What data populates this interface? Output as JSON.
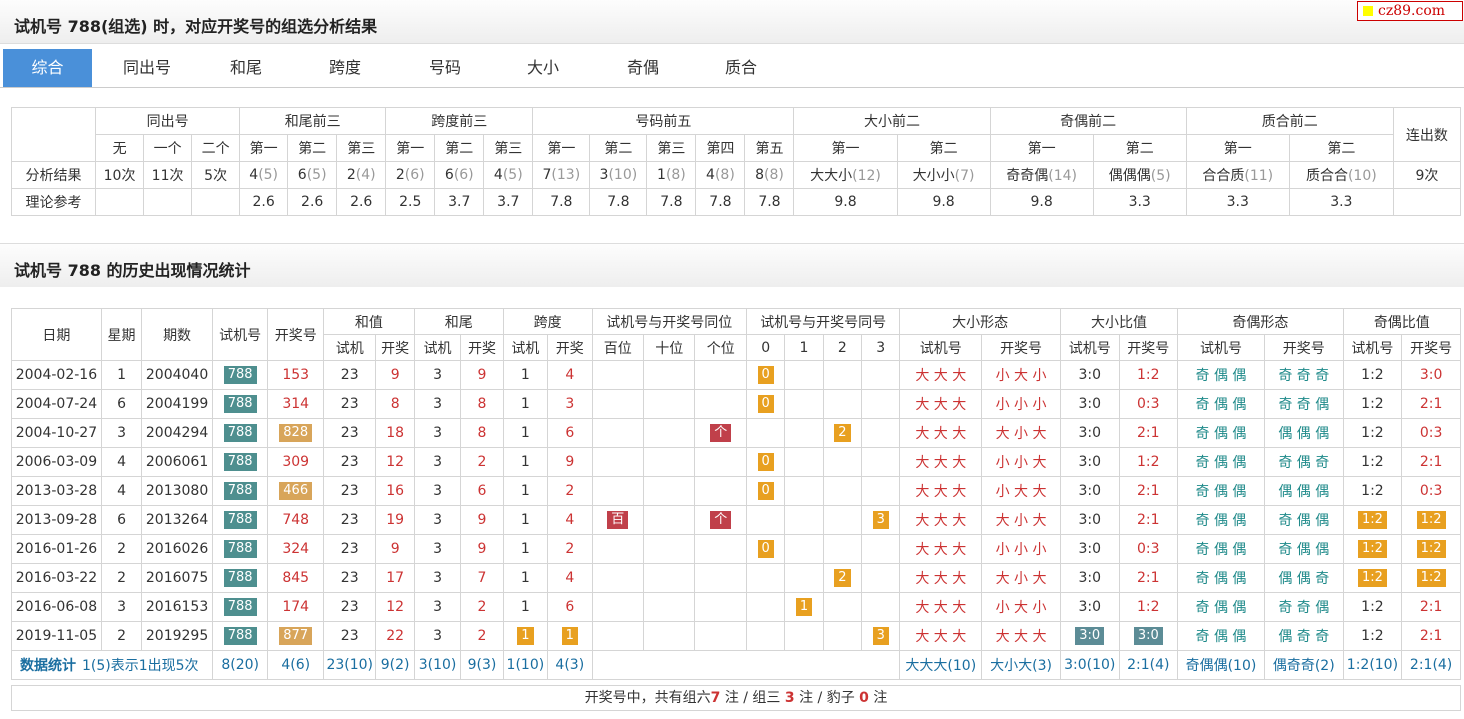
{
  "page_title": "试机号 788(组选) 时，对应开奖号的组选分析结果",
  "logo": "cz89.com",
  "tabs": [
    "综合",
    "同出号",
    "和尾",
    "跨度",
    "号码",
    "大小",
    "奇偶",
    "质合"
  ],
  "analysis": {
    "groups": [
      "同出号",
      "和尾前三",
      "跨度前三",
      "号码前五",
      "大小前二",
      "奇偶前二",
      "质合前二"
    ],
    "last_col": "连出数",
    "sub": [
      "无",
      "一个",
      "二个",
      "第一",
      "第二",
      "第三",
      "第一",
      "第二",
      "第三",
      "第一",
      "第二",
      "第三",
      "第四",
      "第五",
      "第一",
      "第二",
      "第一",
      "第二",
      "第一",
      "第二"
    ],
    "row1_label": "分析结果",
    "row1": [
      [
        "10次",
        ""
      ],
      [
        "11次",
        ""
      ],
      [
        "5次",
        ""
      ],
      [
        "4",
        "(5)"
      ],
      [
        "6",
        "(5)"
      ],
      [
        "2",
        "(4)"
      ],
      [
        "2",
        "(6)"
      ],
      [
        "6",
        "(6)"
      ],
      [
        "4",
        "(5)"
      ],
      [
        "7",
        "(13)"
      ],
      [
        "3",
        "(10)"
      ],
      [
        "1",
        "(8)"
      ],
      [
        "4",
        "(8)"
      ],
      [
        "8",
        "(8)"
      ],
      [
        "大大小",
        "(12)"
      ],
      [
        "大小小",
        "(7)"
      ],
      [
        "奇奇偶",
        "(14)"
      ],
      [
        "偶偶偶",
        "(5)"
      ],
      [
        "合合质",
        "(11)"
      ],
      [
        "质合合",
        "(10)"
      ],
      [
        "9次",
        ""
      ]
    ],
    "row2_label": "理论参考",
    "row2": [
      "",
      "",
      "",
      "2.6",
      "2.6",
      "2.6",
      "2.5",
      "3.7",
      "3.7",
      "7.8",
      "7.8",
      "7.8",
      "7.8",
      "7.8",
      "9.8",
      "9.8",
      "9.8",
      "3.3",
      "3.3",
      "3.3",
      ""
    ]
  },
  "history_title": "试机号 788 的历史出现情况统计",
  "history": {
    "h1": [
      "日期",
      "星期",
      "期数",
      "试机号",
      "开奖号",
      "和值",
      "和尾",
      "跨度",
      "试机号与开奖号同位",
      "试机号与开奖号同号",
      "大小形态",
      "大小比值",
      "奇偶形态",
      "奇偶比值"
    ],
    "h2": [
      "试机",
      "开奖",
      "试机",
      "开奖",
      "试机",
      "开奖",
      "百位",
      "十位",
      "个位",
      "0",
      "1",
      "2",
      "3",
      "试机号",
      "开奖号",
      "试机号",
      "开奖号",
      "试机号",
      "开奖号",
      "试机号",
      "开奖号"
    ],
    "rows": [
      {
        "date": "2004-02-16",
        "week": "1",
        "issue": "2004040",
        "test": "788",
        "win": "153",
        "winbox": "",
        "sum_t": "23",
        "sum_w": "9",
        "tail_t": "3",
        "tail_w": "9",
        "span_t": "1",
        "span_w": "4",
        "spanbox": false,
        "pos": [
          "",
          "",
          ""
        ],
        "same": [
          "0",
          "",
          "",
          ""
        ],
        "dx_t": "大 大 大",
        "dx_w": "小 大 小",
        "dxr_t": "3:0",
        "dxr_w": "1:2",
        "dxrbox": false,
        "jo_t": "奇 偶 偶",
        "jo_w": "奇 奇 奇",
        "jor_t": "1:2",
        "jor_w": "3:0",
        "jorbox": false
      },
      {
        "date": "2004-07-24",
        "week": "6",
        "issue": "2004199",
        "test": "788",
        "win": "314",
        "winbox": "",
        "sum_t": "23",
        "sum_w": "8",
        "tail_t": "3",
        "tail_w": "8",
        "span_t": "1",
        "span_w": "3",
        "spanbox": false,
        "pos": [
          "",
          "",
          ""
        ],
        "same": [
          "0",
          "",
          "",
          ""
        ],
        "dx_t": "大 大 大",
        "dx_w": "小 小 小",
        "dxr_t": "3:0",
        "dxr_w": "0:3",
        "dxrbox": false,
        "jo_t": "奇 偶 偶",
        "jo_w": "奇 奇 偶",
        "jor_t": "1:2",
        "jor_w": "2:1",
        "jorbox": false
      },
      {
        "date": "2004-10-27",
        "week": "3",
        "issue": "2004294",
        "test": "788",
        "win": "828",
        "winbox": "tan",
        "sum_t": "23",
        "sum_w": "18",
        "tail_t": "3",
        "tail_w": "8",
        "span_t": "1",
        "span_w": "6",
        "spanbox": false,
        "pos": [
          "",
          "",
          "个"
        ],
        "same": [
          "",
          "",
          "2",
          ""
        ],
        "dx_t": "大 大 大",
        "dx_w": "大 小 大",
        "dxr_t": "3:0",
        "dxr_w": "2:1",
        "dxrbox": false,
        "jo_t": "奇 偶 偶",
        "jo_w": "偶 偶 偶",
        "jor_t": "1:2",
        "jor_w": "0:3",
        "jorbox": false
      },
      {
        "date": "2006-03-09",
        "week": "4",
        "issue": "2006061",
        "test": "788",
        "win": "309",
        "winbox": "",
        "sum_t": "23",
        "sum_w": "12",
        "tail_t": "3",
        "tail_w": "2",
        "span_t": "1",
        "span_w": "9",
        "spanbox": false,
        "pos": [
          "",
          "",
          ""
        ],
        "same": [
          "0",
          "",
          "",
          ""
        ],
        "dx_t": "大 大 大",
        "dx_w": "小 小 大",
        "dxr_t": "3:0",
        "dxr_w": "1:2",
        "dxrbox": false,
        "jo_t": "奇 偶 偶",
        "jo_w": "奇 偶 奇",
        "jor_t": "1:2",
        "jor_w": "2:1",
        "jorbox": false
      },
      {
        "date": "2013-03-28",
        "week": "4",
        "issue": "2013080",
        "test": "788",
        "win": "466",
        "winbox": "tan",
        "sum_t": "23",
        "sum_w": "16",
        "tail_t": "3",
        "tail_w": "6",
        "span_t": "1",
        "span_w": "2",
        "spanbox": false,
        "pos": [
          "",
          "",
          ""
        ],
        "same": [
          "0",
          "",
          "",
          ""
        ],
        "dx_t": "大 大 大",
        "dx_w": "小 大 大",
        "dxr_t": "3:0",
        "dxr_w": "2:1",
        "dxrbox": false,
        "jo_t": "奇 偶 偶",
        "jo_w": "偶 偶 偶",
        "jor_t": "1:2",
        "jor_w": "0:3",
        "jorbox": false
      },
      {
        "date": "2013-09-28",
        "week": "6",
        "issue": "2013264",
        "test": "788",
        "win": "748",
        "winbox": "",
        "sum_t": "23",
        "sum_w": "19",
        "tail_t": "3",
        "tail_w": "9",
        "span_t": "1",
        "span_w": "4",
        "spanbox": false,
        "pos": [
          "百",
          "",
          "个"
        ],
        "same": [
          "",
          "",
          "",
          "3"
        ],
        "dx_t": "大 大 大",
        "dx_w": "大 小 大",
        "dxr_t": "3:0",
        "dxr_w": "2:1",
        "dxrbox": false,
        "jo_t": "奇 偶 偶",
        "jo_w": "奇 偶 偶",
        "jor_t": "1:2",
        "jor_w": "1:2",
        "jorbox": true
      },
      {
        "date": "2016-01-26",
        "week": "2",
        "issue": "2016026",
        "test": "788",
        "win": "324",
        "winbox": "",
        "sum_t": "23",
        "sum_w": "9",
        "tail_t": "3",
        "tail_w": "9",
        "span_t": "1",
        "span_w": "2",
        "spanbox": false,
        "pos": [
          "",
          "",
          ""
        ],
        "same": [
          "0",
          "",
          "",
          ""
        ],
        "dx_t": "大 大 大",
        "dx_w": "小 小 小",
        "dxr_t": "3:0",
        "dxr_w": "0:3",
        "dxrbox": false,
        "jo_t": "奇 偶 偶",
        "jo_w": "奇 偶 偶",
        "jor_t": "1:2",
        "jor_w": "1:2",
        "jorbox": true
      },
      {
        "date": "2016-03-22",
        "week": "2",
        "issue": "2016075",
        "test": "788",
        "win": "845",
        "winbox": "",
        "sum_t": "23",
        "sum_w": "17",
        "tail_t": "3",
        "tail_w": "7",
        "span_t": "1",
        "span_w": "4",
        "spanbox": false,
        "pos": [
          "",
          "",
          ""
        ],
        "same": [
          "",
          "",
          "2",
          ""
        ],
        "dx_t": "大 大 大",
        "dx_w": "大 小 大",
        "dxr_t": "3:0",
        "dxr_w": "2:1",
        "dxrbox": false,
        "jo_t": "奇 偶 偶",
        "jo_w": "偶 偶 奇",
        "jor_t": "1:2",
        "jor_w": "1:2",
        "jorbox": true
      },
      {
        "date": "2016-06-08",
        "week": "3",
        "issue": "2016153",
        "test": "788",
        "win": "174",
        "winbox": "",
        "sum_t": "23",
        "sum_w": "12",
        "tail_t": "3",
        "tail_w": "2",
        "span_t": "1",
        "span_w": "6",
        "spanbox": false,
        "pos": [
          "",
          "",
          ""
        ],
        "same": [
          "",
          "1",
          "",
          ""
        ],
        "dx_t": "大 大 大",
        "dx_w": "小 大 小",
        "dxr_t": "3:0",
        "dxr_w": "1:2",
        "dxrbox": false,
        "jo_t": "奇 偶 偶",
        "jo_w": "奇 奇 偶",
        "jor_t": "1:2",
        "jor_w": "2:1",
        "jorbox": false
      },
      {
        "date": "2019-11-05",
        "week": "2",
        "issue": "2019295",
        "test": "788",
        "win": "877",
        "winbox": "tan",
        "sum_t": "23",
        "sum_w": "22",
        "tail_t": "3",
        "tail_w": "2",
        "span_t": "1",
        "span_w": "1",
        "spanbox": true,
        "pos": [
          "",
          "",
          ""
        ],
        "same": [
          "",
          "",
          "",
          "3"
        ],
        "dx_t": "大 大 大",
        "dx_w": "大 大 大",
        "dxr_t": "3:0",
        "dxr_w": "3:0",
        "dxrbox": true,
        "jo_t": "奇 偶 偶",
        "jo_w": "偶 奇 奇",
        "jor_t": "1:2",
        "jor_w": "2:1",
        "jorbox": false
      }
    ],
    "stat": [
      "数据统计",
      "1(5)表示1出现5次",
      "8(20)",
      "4(6)",
      "23(10)",
      "9(2)",
      "3(10)",
      "9(3)",
      "1(10)",
      "4(3)",
      "大大大(10)",
      "大小大(3)",
      "3:0(10)",
      "2:1(4)",
      "奇偶偶(10)",
      "偶奇奇(2)",
      "1:2(10)",
      "2:1(4)"
    ],
    "footer": {
      "pre": "开奖号中，共有组六",
      "n6": "7",
      "mid1": "注 / 组三",
      "n3": "3",
      "mid2": "注 / 豹子",
      "nb": "0",
      "post": "注"
    }
  }
}
